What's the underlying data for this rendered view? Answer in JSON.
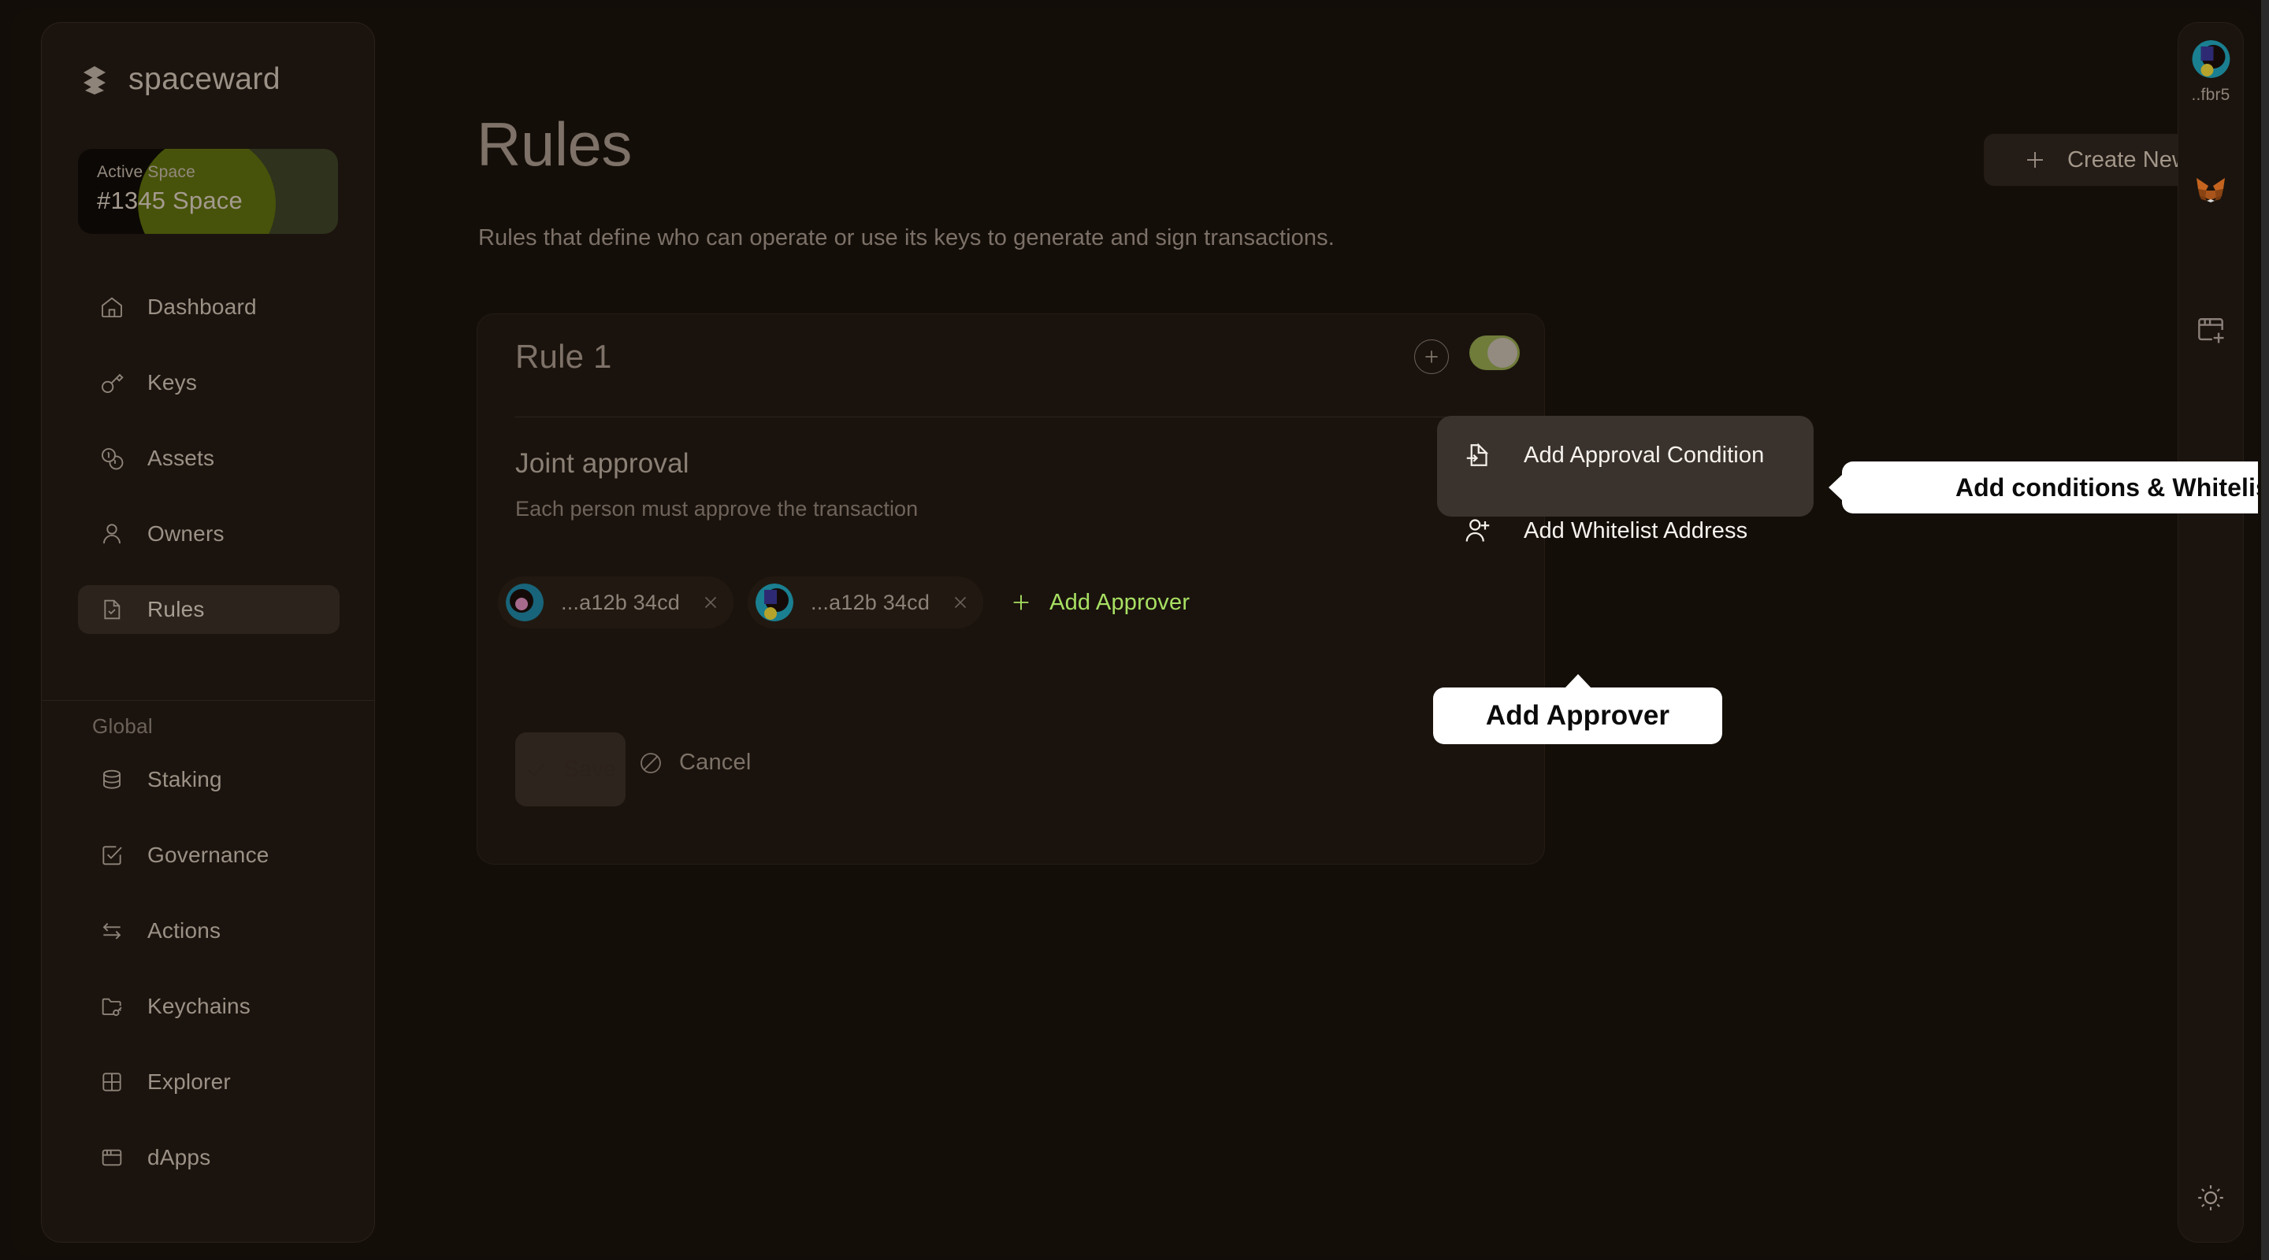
{
  "brand": {
    "name": "spaceward",
    "logo_icon": "spaceward-logo-icon"
  },
  "active_space": {
    "label": "Active Space",
    "value": "#1345 Space"
  },
  "sidebar": {
    "main_items": [
      {
        "label": "Dashboard",
        "icon": "home-icon",
        "active": false
      },
      {
        "label": "Keys",
        "icon": "key-icon",
        "active": false
      },
      {
        "label": "Assets",
        "icon": "coins-icon",
        "active": false
      },
      {
        "label": "Owners",
        "icon": "user-icon",
        "active": false
      },
      {
        "label": "Rules",
        "icon": "document-check-icon",
        "active": true
      }
    ],
    "global_heading": "Global",
    "global_items": [
      {
        "label": "Staking",
        "icon": "database-icon"
      },
      {
        "label": "Governance",
        "icon": "checkbox-check-icon"
      },
      {
        "label": "Actions",
        "icon": "swap-arrows-icon"
      },
      {
        "label": "Keychains",
        "icon": "folder-key-icon"
      },
      {
        "label": "Explorer",
        "icon": "grid-icon"
      },
      {
        "label": "dApps",
        "icon": "browser-window-icon"
      }
    ]
  },
  "header": {
    "title": "Rules",
    "subtitle": "Rules that define who can operate or use its keys to generate and sign transactions.",
    "create_new_label": "Create New",
    "create_new_icon": "plus-icon"
  },
  "rule_card": {
    "title": "Rule 1",
    "add_icon": "plus-circle-icon",
    "toggle_on": true,
    "toggle_track_color": "#6f7c3a",
    "toggle_knob_color": "#938a80",
    "section_title": "Joint approval",
    "section_subtitle": "Each person must approve the transaction",
    "approvers": [
      {
        "address": "...a12b 34cd",
        "remove_icon": "close-icon"
      },
      {
        "address": "...a12b 34cd",
        "remove_icon": "close-icon"
      }
    ],
    "add_approver_label": "Add Approver",
    "add_approver_icon": "plus-icon",
    "add_approver_color": "#a8e063",
    "save_label": "Save",
    "save_icon": "check-icon",
    "cancel_label": "Cancel",
    "cancel_icon": "ban-icon"
  },
  "add_menu": {
    "items": [
      {
        "label": "Add Approval Condition",
        "icon": "file-import-icon"
      },
      {
        "label": "Add Whitelist Address",
        "icon": "user-plus-icon"
      }
    ]
  },
  "callouts": {
    "conditions": "Add conditions & Whitelist address",
    "approver": "Add Approver"
  },
  "right_rail": {
    "account_label": "..fbr5",
    "account_icon": "avatar-icon",
    "wallet_icon": "metamask-fox-icon",
    "newtab_icon": "browser-window-plus-icon",
    "theme_icon": "sun-icon"
  }
}
